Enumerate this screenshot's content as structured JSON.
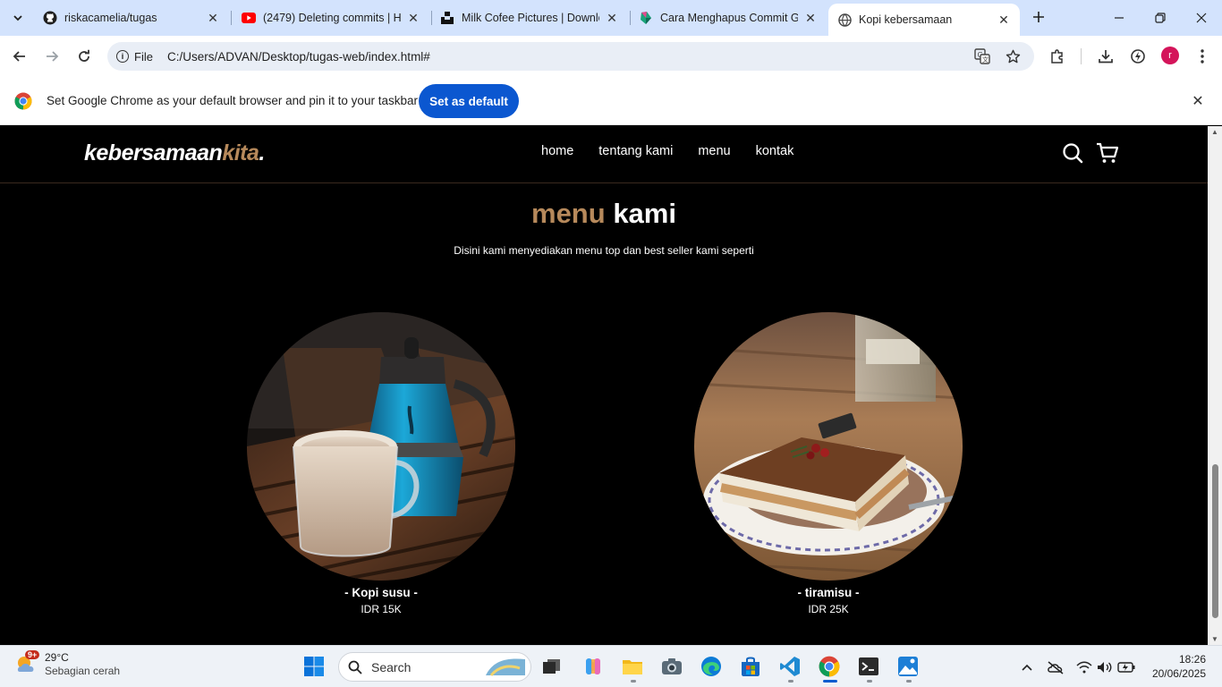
{
  "browser": {
    "tabs": [
      {
        "title": "riskacamelia/tugas",
        "icon": "github-icon"
      },
      {
        "title": "(2479) Deleting commits | Hu",
        "icon": "youtube-icon"
      },
      {
        "title": "Milk Cofee Pictures | Downlo",
        "icon": "unsplash-icon"
      },
      {
        "title": "Cara Menghapus Commit Gi",
        "icon": "gitkraken-icon"
      },
      {
        "title": "Kopi kebersamaan",
        "icon": "globe-icon",
        "active": true
      }
    ],
    "address": {
      "scheme_label": "File",
      "url": "C:/Users/ADVAN/Desktop/tugas-web/index.html#"
    },
    "avatar_letter": "r",
    "infobar": {
      "text": "Set Google Chrome as your default browser and pin it to your taskbar",
      "button_label": "Set as default"
    }
  },
  "site": {
    "logo": {
      "main": "kebersamaan",
      "accent": "kita",
      "dot": "."
    },
    "nav": [
      "home",
      "tentang kami",
      "menu",
      "kontak"
    ],
    "accent_color": "#b6895b",
    "section": {
      "title_accent": "menu",
      "title_main": "kami",
      "description": "Disini kami menyediakan menu top dan best seller kami seperti"
    },
    "items": [
      {
        "name": "- Kopi susu -",
        "price": "IDR 15K"
      },
      {
        "name": "- tiramisu -",
        "price": "IDR 25K"
      }
    ]
  },
  "taskbar": {
    "weather": {
      "temp": "29°C",
      "desc": "Sebagian cerah",
      "badge": "9+"
    },
    "search_label": "Search",
    "clock": {
      "time": "18:26",
      "date": "20/06/2025"
    }
  }
}
